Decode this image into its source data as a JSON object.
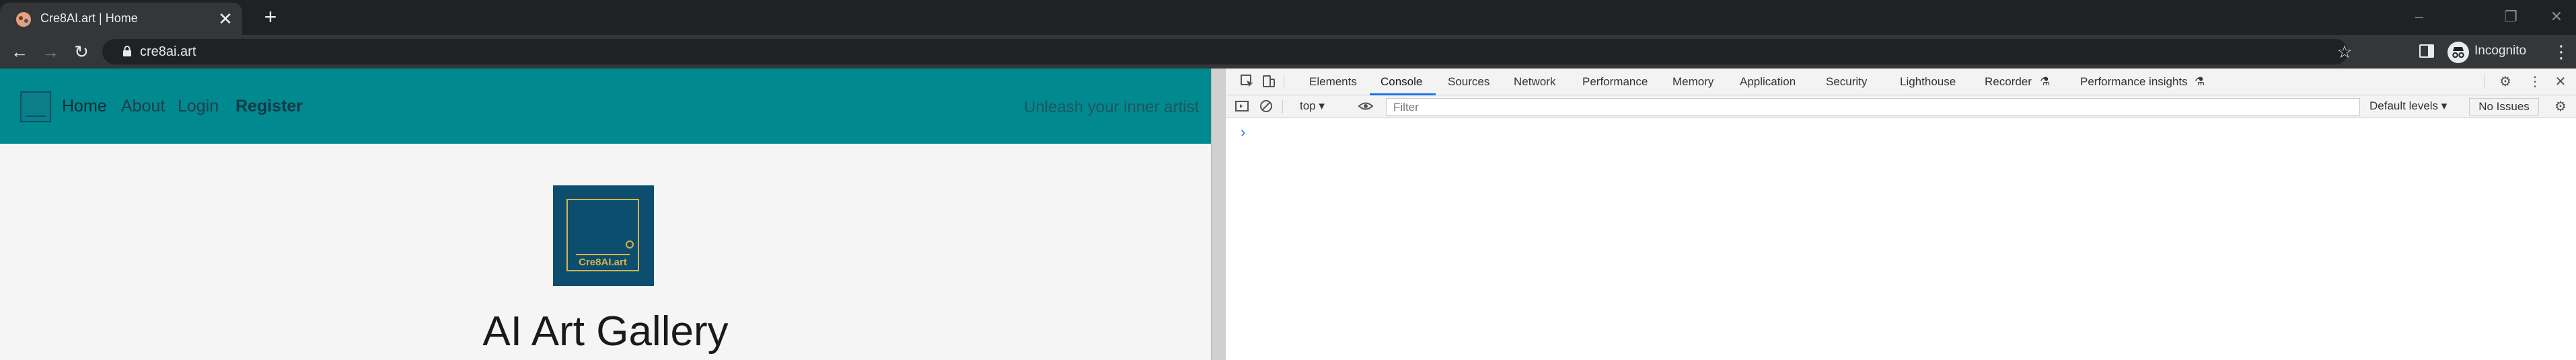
{
  "browser": {
    "tab": {
      "title": "Cre8AI.art | Home",
      "close_glyph": "✕"
    },
    "new_tab_glyph": "+",
    "window_controls": [
      "–",
      "❐",
      "✕"
    ],
    "toolbar": {
      "back_glyph": "←",
      "forward_glyph": "→",
      "reload_glyph": "↻",
      "url": "cre8ai.art",
      "star_glyph": "☆",
      "profile_label": "Incognito",
      "menu_glyph": "⋮"
    }
  },
  "site": {
    "nav": {
      "home": "Home",
      "about": "About",
      "login": "Login",
      "register": "Register",
      "tagline": "Unleash your inner artist"
    },
    "logo_text": "Cre8AI.art",
    "heading": "AI Art Gallery",
    "colors": {
      "nav_bg": "#00898f",
      "logo_bg": "#0d4d6e",
      "logo_gold": "#d8b24a"
    }
  },
  "devtools": {
    "tabs": [
      "Elements",
      "Console",
      "Sources",
      "Network",
      "Performance",
      "Memory",
      "Application",
      "Security",
      "Lighthouse",
      "Recorder",
      "Performance insights"
    ],
    "selected_tab": "Console",
    "experimental_glyph": "⚗",
    "context": "top ▾",
    "filter_placeholder": "Filter",
    "levels_label": "Default levels ▾",
    "issues_label": "No Issues",
    "prompt_glyph": "›",
    "settings_glyph": "⚙",
    "more_glyph": "⋮",
    "close_glyph": "✕"
  }
}
